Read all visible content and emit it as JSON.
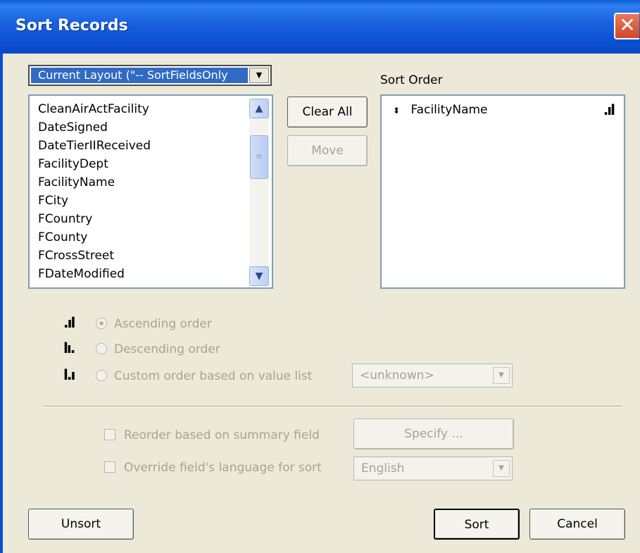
{
  "window": {
    "title": "Sort Records",
    "close_glyph": "✕"
  },
  "layout_select": {
    "value": "Current Layout (\"-- SortFieldsOnly",
    "arrow_glyph": "▼"
  },
  "field_list": {
    "items": [
      "CleanAirActFacility",
      "DateSigned",
      "DateTierIIReceived",
      "FacilityDept",
      "FacilityName",
      "FCity",
      "FCountry",
      "FCounty",
      "FCrossStreet",
      "FDateModified"
    ],
    "scroll_up_glyph": "▲",
    "scroll_down_glyph": "▼",
    "thumb_grip": "≡"
  },
  "buttons": {
    "clear_all": "Clear All",
    "move": "Move",
    "specify": "Specify ...",
    "unsort": "Unsort",
    "sort": "Sort",
    "cancel": "Cancel"
  },
  "sort_order": {
    "label": "Sort Order",
    "items": [
      {
        "name": "FacilityName",
        "move_glyph": "⬍",
        "order_icon": "ascending-order-icon",
        "order_glyph": ".ıl"
      }
    ]
  },
  "order_options": {
    "ascending": {
      "label": "Ascending order",
      "icon": "ascending-order-icon",
      "glyph": ".ıl",
      "selected": true
    },
    "descending": {
      "label": "Descending order",
      "icon": "descending-order-icon",
      "glyph": "lı.",
      "selected": false
    },
    "custom": {
      "label": "Custom order based on value list",
      "icon": "custom-order-icon",
      "glyph": "l.ı",
      "selected": false
    },
    "value_list_value": "<unknown>",
    "combo_arrow_glyph": "▼"
  },
  "options": {
    "reorder_summary": "Reorder based on summary field",
    "override_language": "Override field's language for sort",
    "language_value": "English"
  },
  "colors": {
    "titlebar": "#0b4fd1",
    "selection": "#316ac5",
    "dialog_bg": "#ece9d8",
    "disabled_text": "#a6a392",
    "close_button": "#d3472a"
  }
}
